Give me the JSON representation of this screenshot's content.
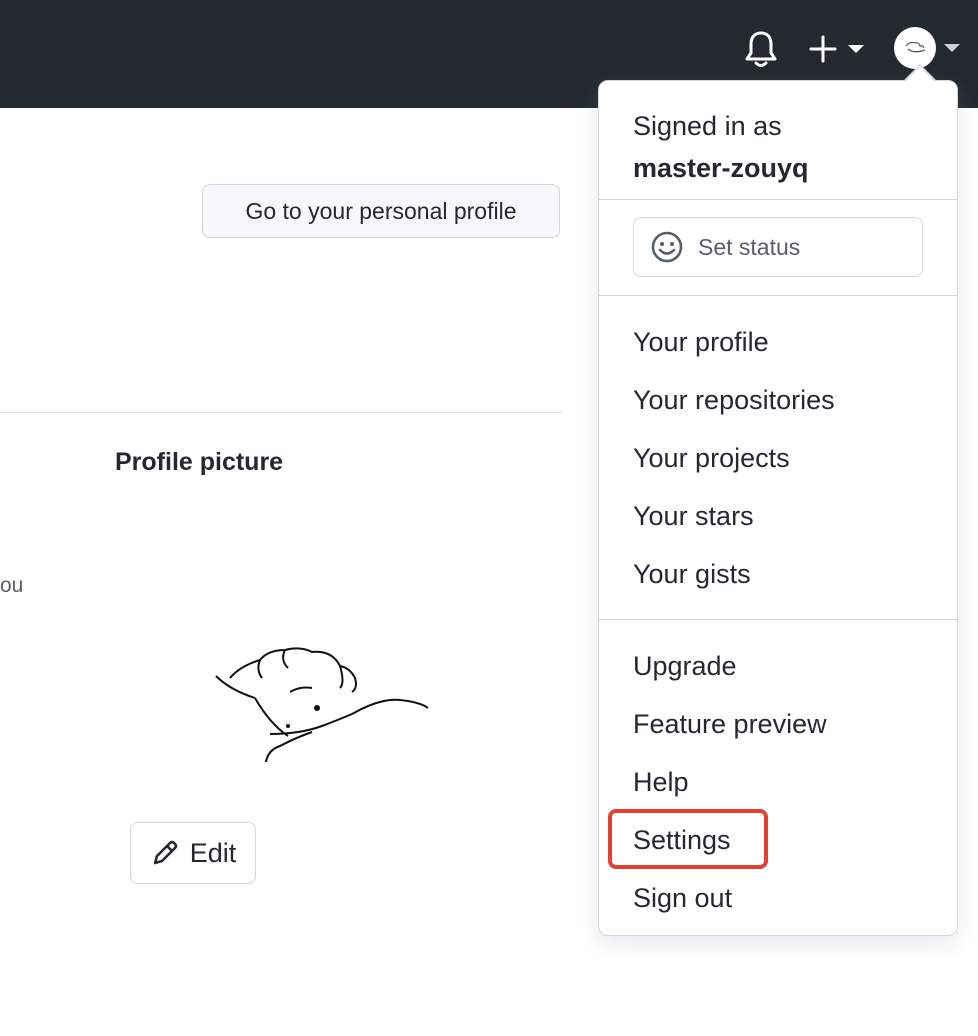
{
  "header": {
    "icons": {
      "notifications": "bell-icon",
      "create": "plus-icon",
      "avatar": "avatar-image"
    }
  },
  "main": {
    "profile_button": "Go to your personal profile",
    "profile_picture_title": "Profile picture",
    "partial_text": "ou",
    "edit_button": "Edit"
  },
  "menu": {
    "signed_in_label": "Signed in as",
    "username": "master-zouyq",
    "set_status": "Set status",
    "group1": [
      "Your profile",
      "Your repositories",
      "Your projects",
      "Your stars",
      "Your gists"
    ],
    "group2": [
      "Upgrade",
      "Feature preview",
      "Help",
      "Settings",
      "Sign out"
    ],
    "highlight_color": "#e4402f"
  }
}
